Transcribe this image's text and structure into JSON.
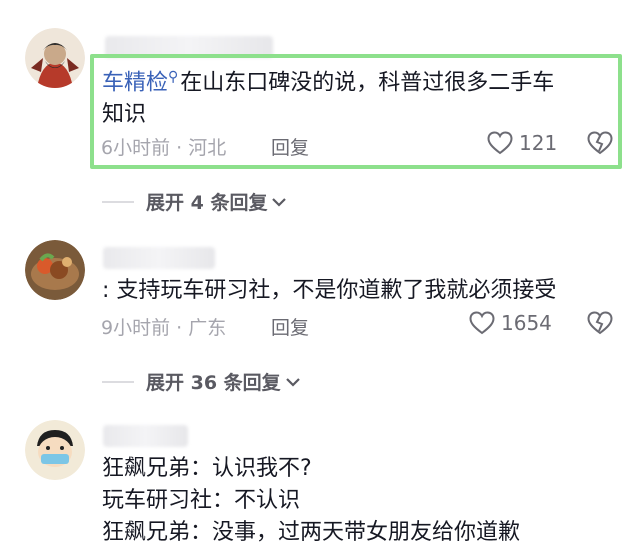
{
  "comments": [
    {
      "mention": "车精检",
      "text": "在山东口碑没的说，科普过很多二手车知识",
      "line1": "在山东口碑没的说，科普过很多二手车",
      "line2": "知识",
      "time_loc": "6小时前 · 河北",
      "reply_label": "回复",
      "likes": "121",
      "expand_label": "展开 4 条回复"
    },
    {
      "text": ": 支持玩车研习社，不是你道歉了我就必须接受",
      "time_loc": "9小时前 · 广东",
      "reply_label": "回复",
      "likes": "1654",
      "expand_label": "展开 36 条回复"
    },
    {
      "line1": "狂飙兄弟：认识我不?",
      "line2": "玩车研习社：不认识",
      "line3": "狂飙兄弟：没事，过两天带女朋友给你道歉"
    }
  ]
}
